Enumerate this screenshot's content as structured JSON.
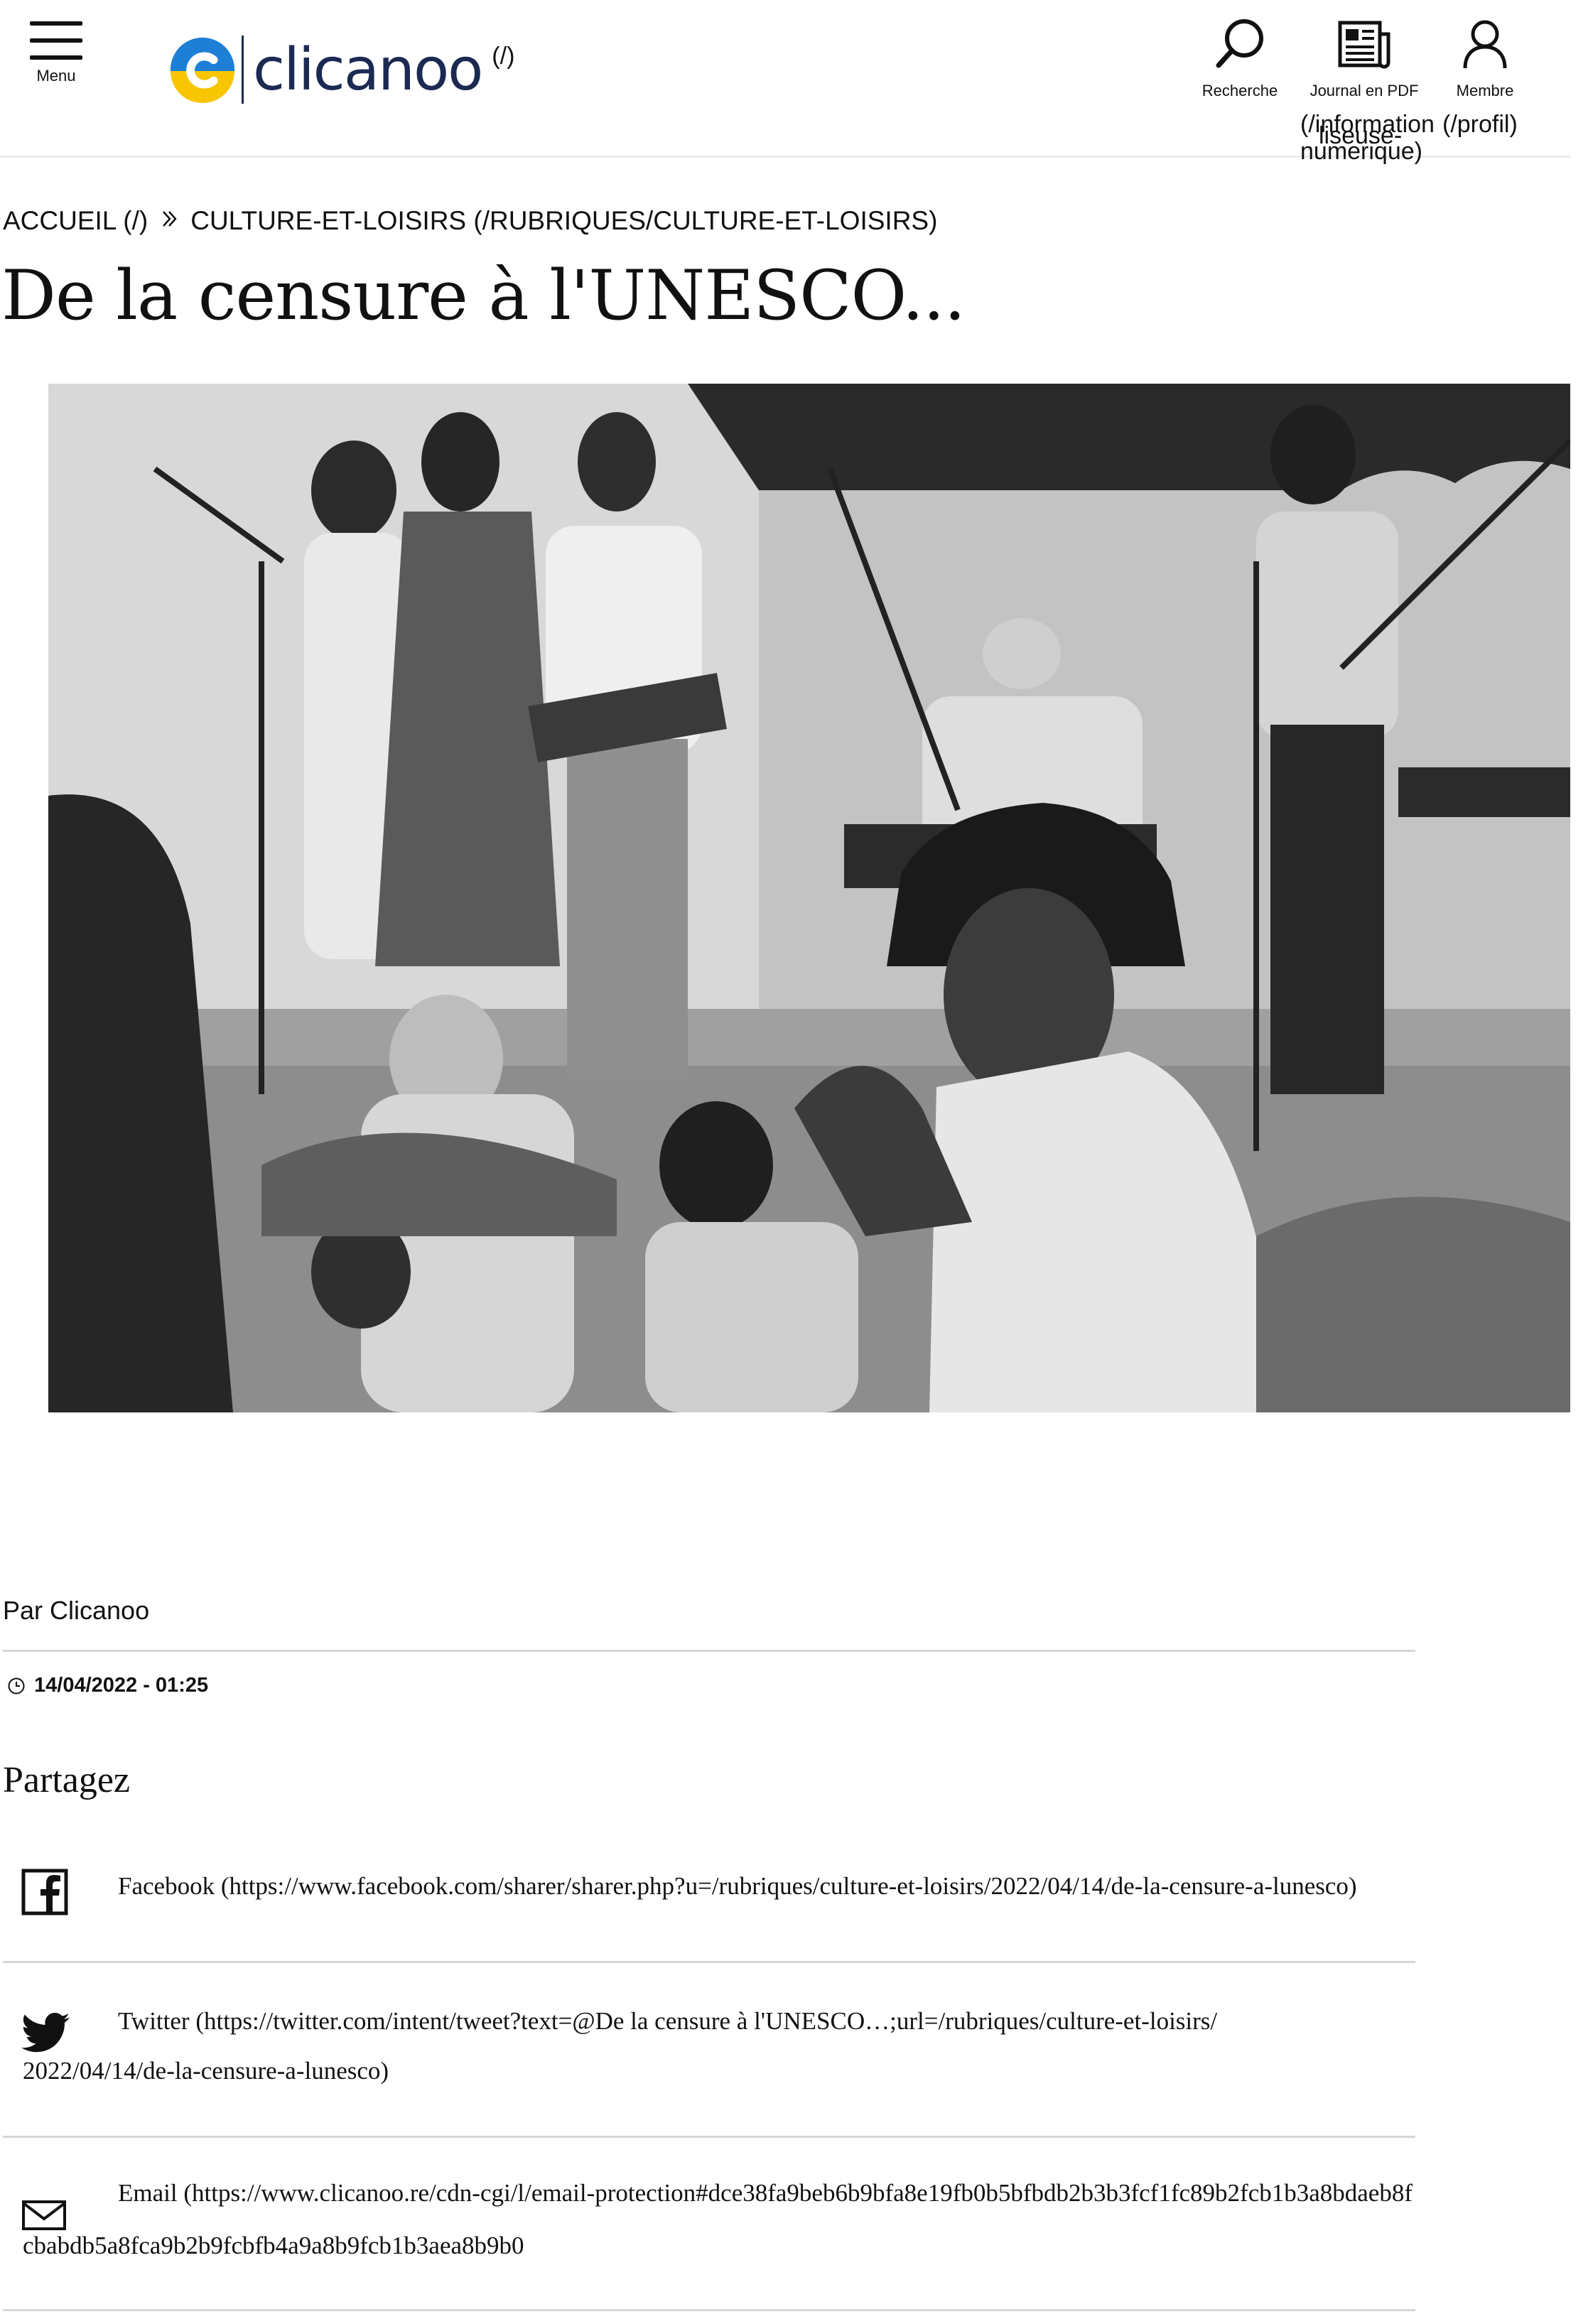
{
  "header": {
    "menu_label": "Menu",
    "logo_text": "clicanoo",
    "logo_link": "(/)",
    "search_label": "Recherche",
    "pdf_label": "Journal en PDF",
    "member_label": "Membre",
    "pdf_link_line1": "(/information",
    "pdf_link_overlap": "liseuse-",
    "pdf_link_line2": "numerique)",
    "member_link": "(/profil)"
  },
  "breadcrumb": {
    "home": "ACCUEIL (/)",
    "section": "CULTURE-ET-LOISIRS (/RUBRIQUES/CULTURE-ET-LOISIRS)"
  },
  "article": {
    "title": "De la censure à l'UNESCO...",
    "byline": "Par Clicanoo",
    "date": "14/04/2022 - 01:25"
  },
  "share": {
    "title": "Partagez",
    "facebook": "Facebook (https://www.facebook.com/sharer/sharer.php?u=/rubriques/culture-et-loisirs/2022/04/14/de-la-censure-a-lunesco)",
    "twitter": "Twitter (https://twitter.com/intent/tweet?text=@De la censure à l'UNESCO…;url=/rubriques/culture-et-loisirs/2022/04/14/de-la-censure-a-lunesco)",
    "email": "Email (https://www.clicanoo.re/cdn-cgi/l/email-protection#dce38fa9beb6b9bfa8e19fb0b5bfbdb2b3b3fcf1fc89b2fcb1b3a8bdaeb8fcbabdb5a8fca9b2b9fcbfb4a9a8b9fcb1b3aea8b9b0"
  },
  "colors": {
    "logo_yellow": "#f7c600",
    "logo_blue": "#1e7fd6",
    "logo_navy": "#1b2a53"
  }
}
